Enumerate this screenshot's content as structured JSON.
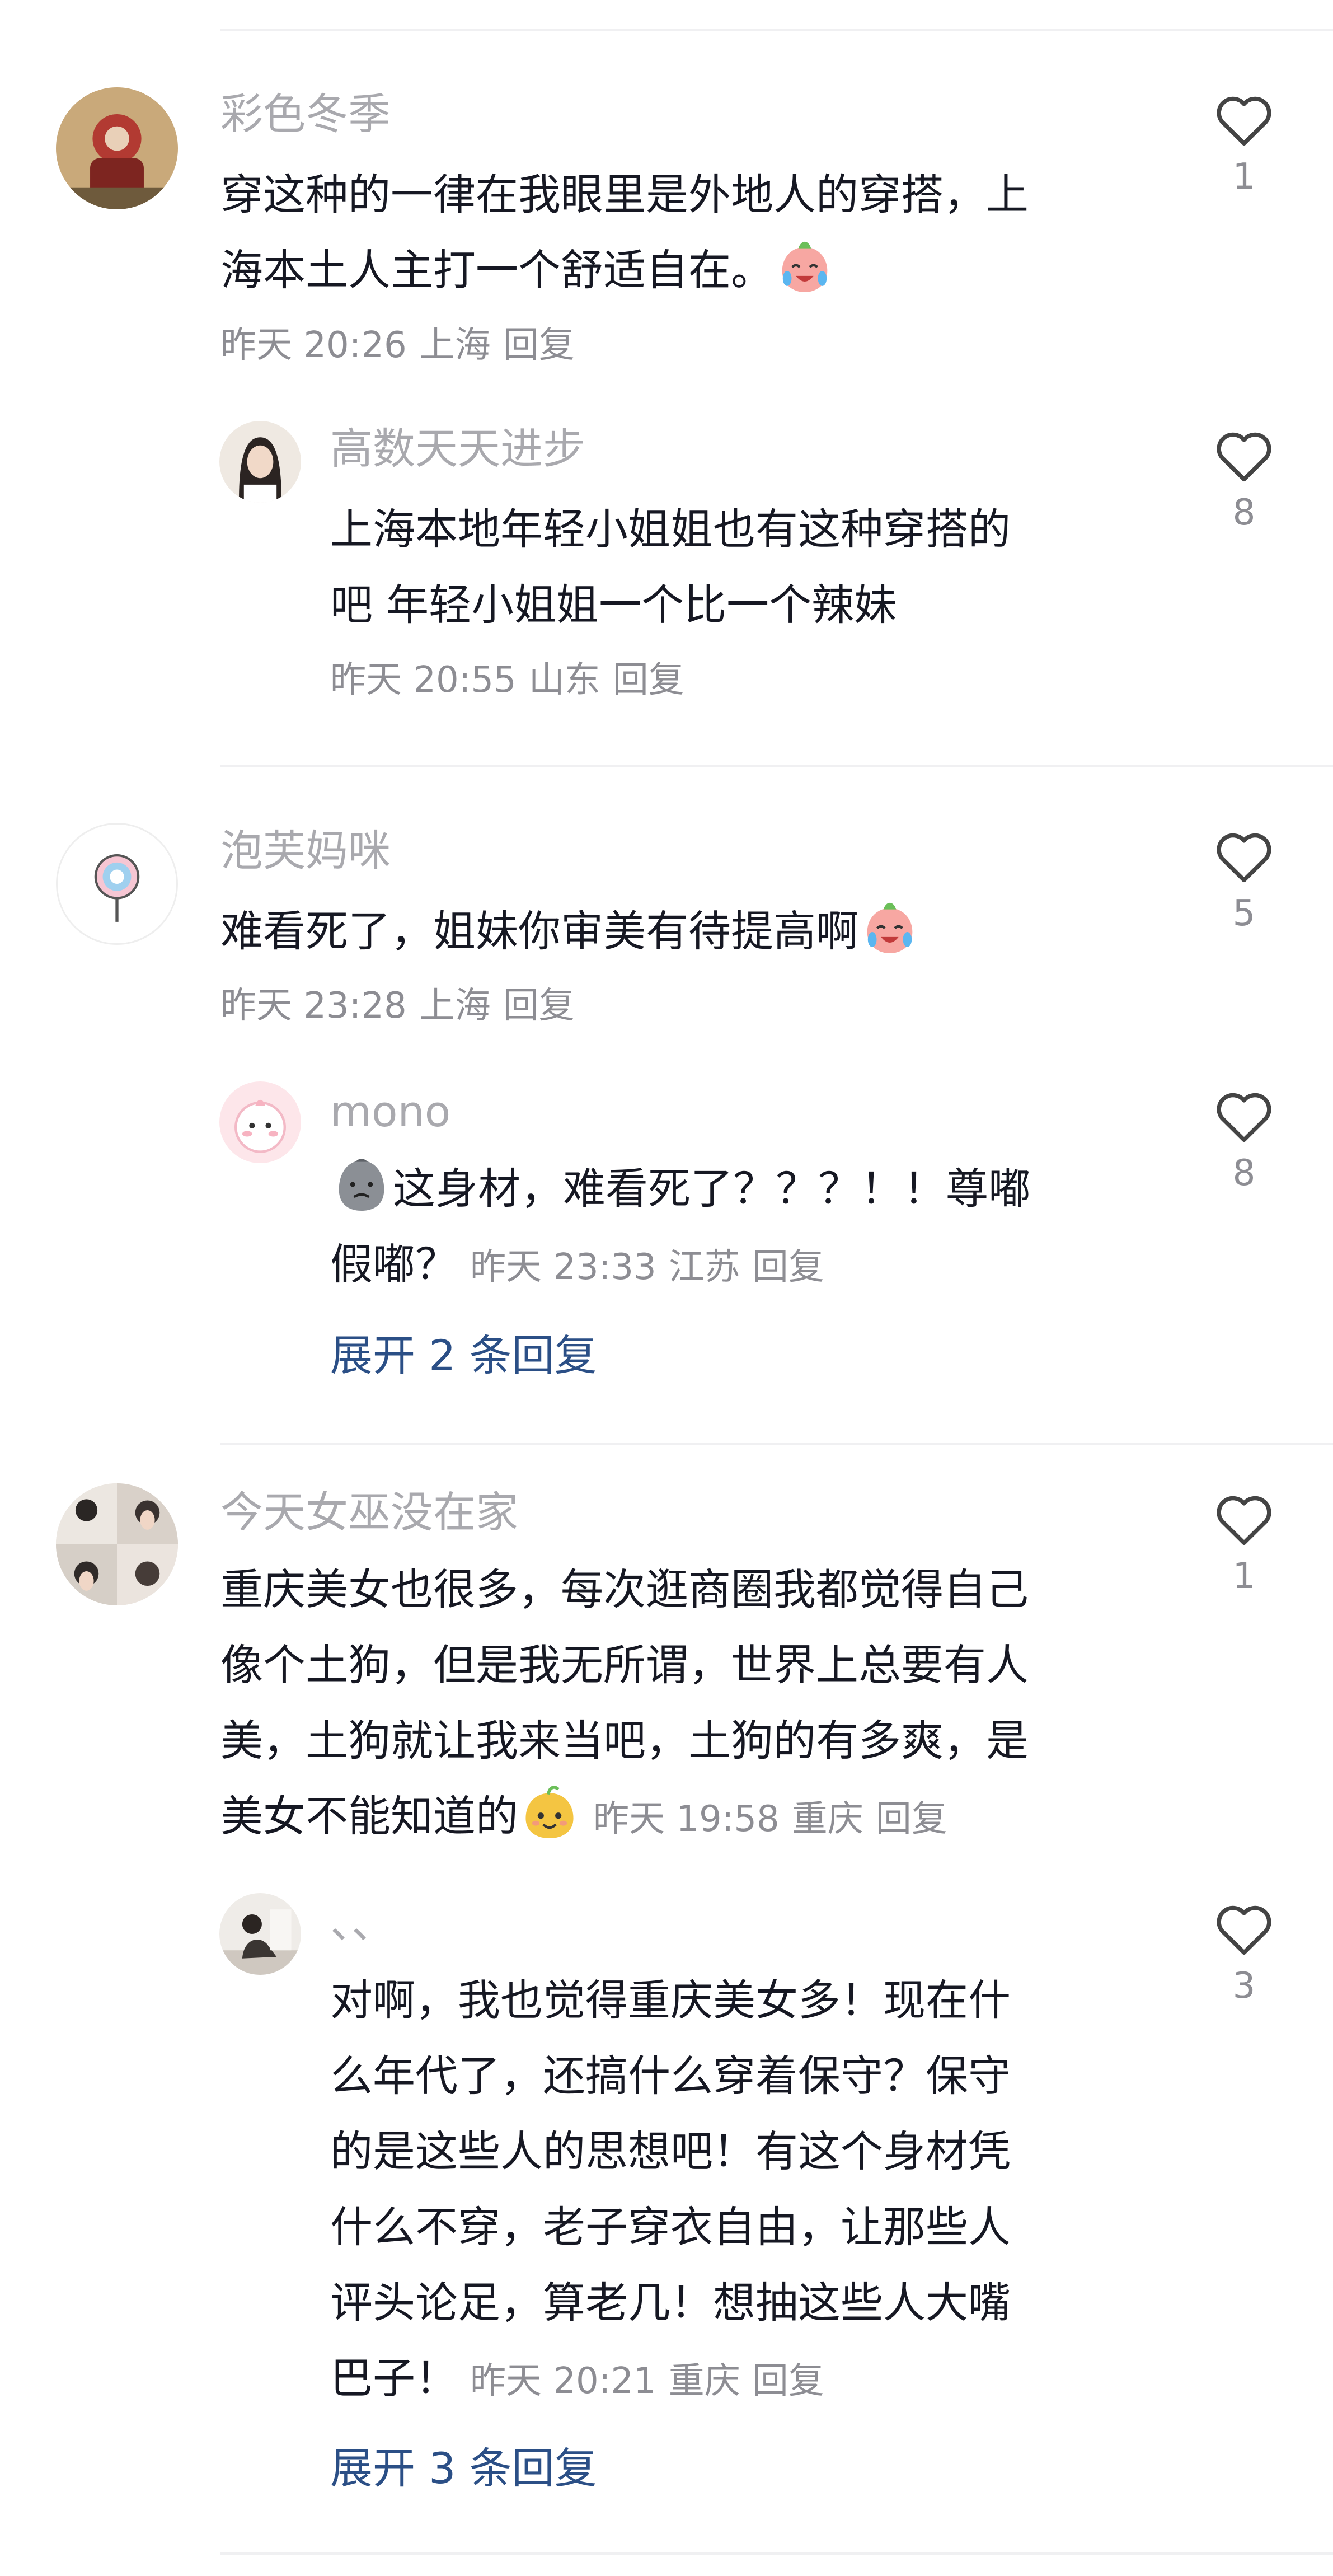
{
  "comments": [
    {
      "user": "彩色冬季",
      "lines": [
        "穿这种的一律在我眼里是外地人的穿搭，上",
        "海本土人主打一个舒适自在。"
      ],
      "time": "昨天 20:26",
      "location": "上海",
      "reply_label": "回复",
      "likes": "1",
      "emoji": "crying-laughing-peach-emoji"
    },
    {
      "user": "高数天天进步",
      "lines": [
        "上海本地年轻小姐姐也有这种穿搭的",
        "吧 年轻小姐姐一个比一个辣妹"
      ],
      "time": "昨天 20:55",
      "location": "山东",
      "reply_label": "回复",
      "likes": "8"
    },
    {
      "user": "泡芙妈咪",
      "lines": [
        "难看死了，姐妹你审美有待提高啊"
      ],
      "time": "昨天 23:28",
      "location": "上海",
      "reply_label": "回复",
      "likes": "5",
      "emoji": "crying-laughing-peach-emoji"
    },
    {
      "user": "mono",
      "lines": [
        "这身材，难看死了？？？！！尊嘟",
        "假嘟？"
      ],
      "time": "昨天 23:33",
      "location": "江苏",
      "reply_label": "回复",
      "likes": "8",
      "emoji": "grey-blob-emoji",
      "expand": "展开 2 条回复"
    },
    {
      "user": "今天女巫没在家",
      "lines": [
        "重庆美女也很多，每次逛商圈我都觉得自己",
        "像个土狗，但是我无所谓，世界上总要有人",
        "美，土狗就让我来当吧，土狗的有多爽，是",
        "美女不能知道的"
      ],
      "time": "昨天 19:58",
      "location": "重庆",
      "reply_label": "回复",
      "likes": "1",
      "emoji": "yellow-smile-emoji"
    },
    {
      "user": "、、",
      "lines": [
        "对啊，我也觉得重庆美女多！现在什",
        "么年代了，还搞什么穿着保守？保守",
        "的是这些人的思想吧！有这个身材凭",
        "什么不穿，老子穿衣自由，让那些人",
        "评头论足，算老几！想抽这些人大嘴",
        "巴子！"
      ],
      "time": "昨天 20:21",
      "location": "重庆",
      "reply_label": "回复",
      "likes": "3",
      "expand": "展开 3 条回复"
    }
  ],
  "icons": {
    "like": "heart-outline-icon"
  },
  "colors": {
    "text": "#161823",
    "muted": "#a9a9ae",
    "link": "#2b4f86",
    "divider": "#f0f0f2"
  }
}
